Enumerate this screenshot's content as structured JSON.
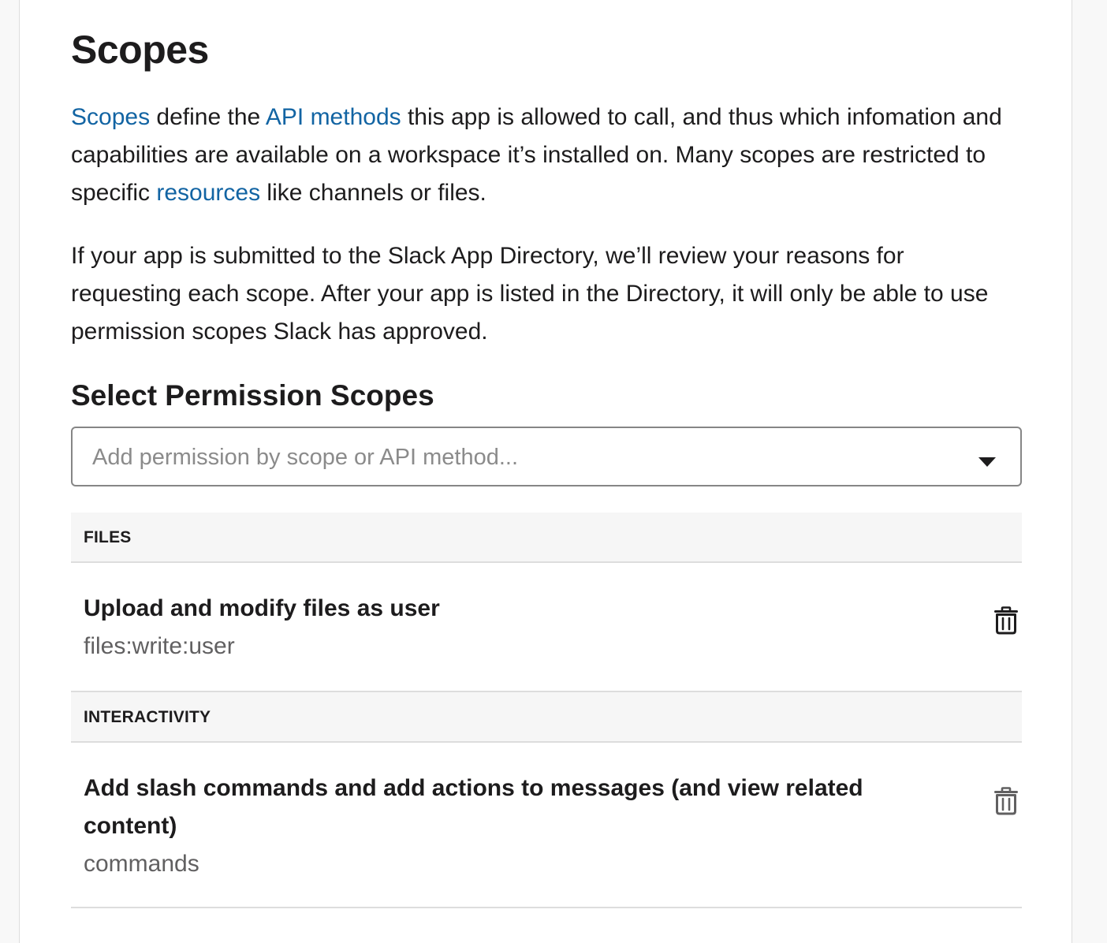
{
  "page": {
    "title": "Scopes",
    "intro": {
      "link_scopes": "Scopes",
      "text_1": " define the ",
      "link_api_methods": "API methods",
      "text_2": " this app is allowed to call, and thus which infomation and capabilities are available on a workspace it’s installed on. Many scopes are restricted to specific ",
      "link_resources": "resources",
      "text_3": " like channels or files."
    },
    "review_note": "If your app is submitted to the Slack App Directory, we’ll review your reasons for requesting each scope. After your app is listed in the Directory, it will only be able to use permission scopes Slack has approved."
  },
  "permission_scopes": {
    "heading": "Select Permission Scopes",
    "select": {
      "placeholder": "Add permission by scope or API method..."
    },
    "groups": [
      {
        "label": "FILES",
        "scopes": [
          {
            "title": "Upload and modify files as user",
            "name": "files:write:user",
            "delete_icon": "trash-icon"
          }
        ]
      },
      {
        "label": "INTERACTIVITY",
        "scopes": [
          {
            "title": "Add slash commands and add actions to messages (and view related content)",
            "name": "commands",
            "delete_icon": "trash-icon"
          }
        ]
      }
    ]
  },
  "colors": {
    "link": "#1264a3",
    "text": "#1d1c1d",
    "muted": "#616061",
    "group_header_bg": "#f6f6f6"
  }
}
